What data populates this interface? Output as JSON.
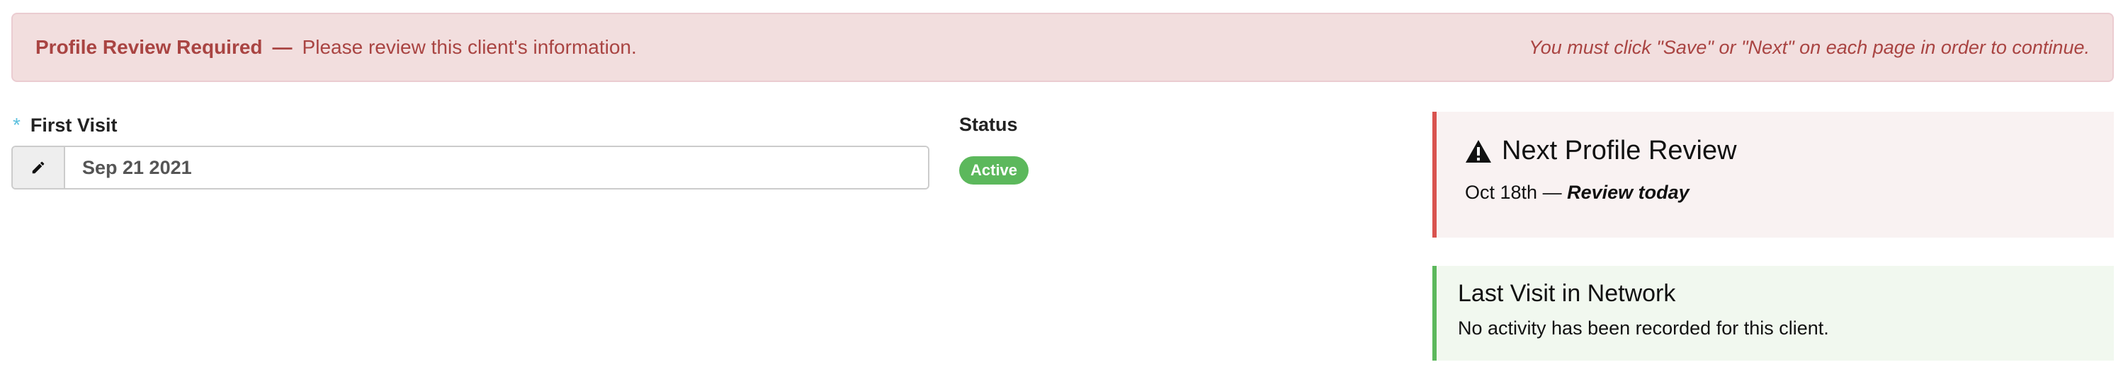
{
  "banner": {
    "title": "Profile Review Required",
    "dash": "—",
    "message": "Please review this client's information.",
    "notice": "You must click \"Save\" or \"Next\" on each page in order to continue."
  },
  "form": {
    "first_visit": {
      "required_marker": "*",
      "label": "First Visit",
      "value": "Sep 21 2021",
      "icon": "pencil-icon"
    },
    "status": {
      "label": "Status",
      "value": "Active",
      "color": "#5cb85c"
    }
  },
  "next_review": {
    "icon": "warning-icon",
    "title": "Next Profile Review",
    "date": "Oct 18th",
    "separator": "—",
    "emphasis": "Review today",
    "accent": "#d9534f"
  },
  "last_visit": {
    "title": "Last Visit in Network",
    "message": "No activity has been recorded for this client.",
    "accent": "#5cb85c"
  }
}
